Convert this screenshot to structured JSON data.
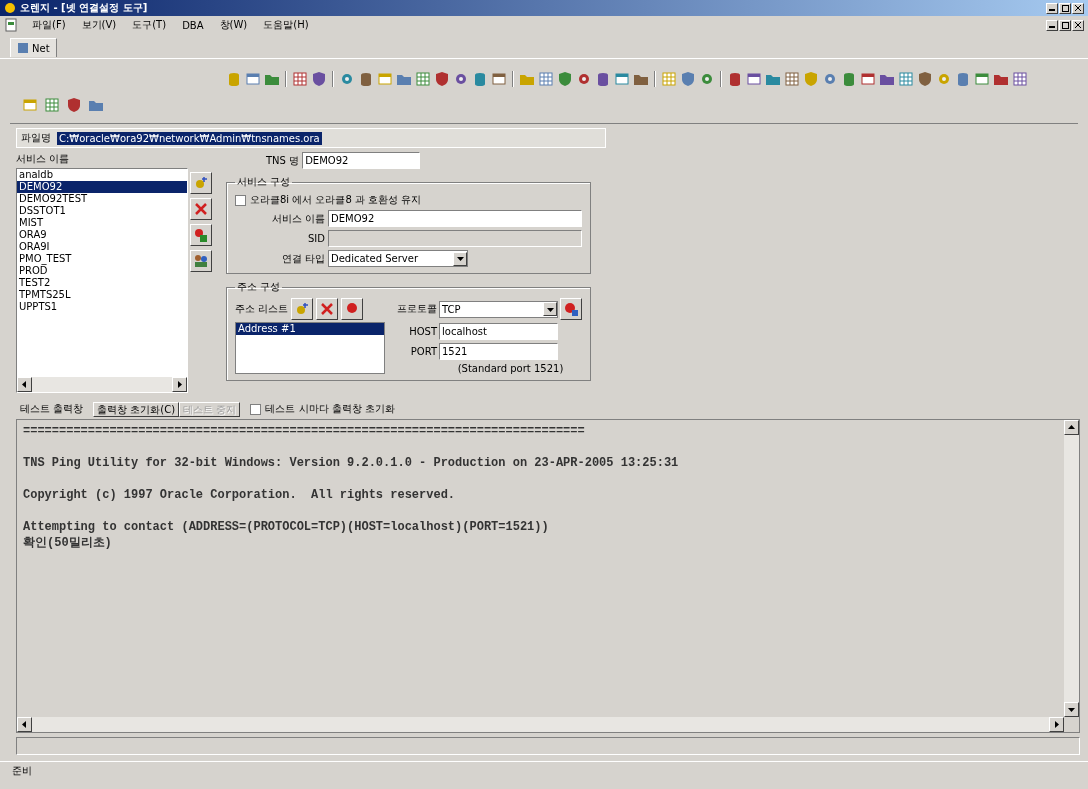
{
  "window": {
    "title": "오렌지 - [넷 연결설정 도구]"
  },
  "menu": [
    "파일(F)",
    "보기(V)",
    "도구(T)",
    "DBA",
    "창(W)",
    "도움말(H)"
  ],
  "tabs": [
    {
      "label": "Net",
      "selected": true
    }
  ],
  "file": {
    "label": "파일명",
    "value": "C:₩oracle₩ora92₩network₩Admin₩tnsnames.ora"
  },
  "services": {
    "label": "서비스 이름",
    "items": [
      {
        "name": "analdb",
        "selected": false
      },
      {
        "name": "DEMO92",
        "selected": true
      },
      {
        "name": "DEMO92TEST",
        "selected": false
      },
      {
        "name": "DSSTOT1",
        "selected": false
      },
      {
        "name": "MIST",
        "selected": false
      },
      {
        "name": "ORA9",
        "selected": false
      },
      {
        "name": "ORA9I",
        "selected": false
      },
      {
        "name": "PMO_TEST",
        "selected": false
      },
      {
        "name": "PROD",
        "selected": false
      },
      {
        "name": "TEST2",
        "selected": false
      },
      {
        "name": "TPMTS25L",
        "selected": false
      },
      {
        "name": "UPPTS1",
        "selected": false
      }
    ]
  },
  "tns_name": {
    "label": "TNS 명",
    "value": "DEMO92"
  },
  "service_config": {
    "title": "서비스 구성",
    "compat": {
      "label": "오라클8i 에서 오라클8 과 호환성 유지",
      "checked": false
    },
    "service_name": {
      "label": "서비스 이름",
      "value": "DEMO92"
    },
    "sid": {
      "label": "SID",
      "disabled": true
    },
    "connection_type": {
      "label": "연결 타입",
      "value": "Dedicated Server"
    }
  },
  "address_config": {
    "title": "주소 구성",
    "list_label": "주소 리스트",
    "addresses": [
      {
        "name": "Address #1",
        "selected": true
      }
    ],
    "protocol": {
      "label": "프로토콜",
      "value": "TCP"
    },
    "host": {
      "label": "HOST",
      "value": "localhost"
    },
    "port": {
      "label": "PORT",
      "value": "1521"
    },
    "port_hint": "(Standard port 1521)"
  },
  "test": {
    "label": "테스트 출력창",
    "buttons": [
      {
        "label": "출력창 초기화(C)",
        "disabled": false
      },
      {
        "label": "테스트 중지",
        "disabled": true
      }
    ],
    "clear_each": {
      "label": "테스트 시마다 출력창 초기화",
      "checked": false
    },
    "output": [
      [
        "=============================================================================="
      ],
      [
        "TNS Ping Utility for 32-bit Windows: Version 9.2.0.1.0 - Production on 23-APR-2005 13:25:31"
      ],
      [
        "Copyright (c) 1997 Oracle Corporation.  All rights reserved."
      ],
      [
        "Attempting to contact (ADDRESS=(PROTOCOL=TCP)(HOST=localhost)(PORT=1521))",
        "확인(50밀리초)"
      ]
    ]
  },
  "status_bar": "준비"
}
